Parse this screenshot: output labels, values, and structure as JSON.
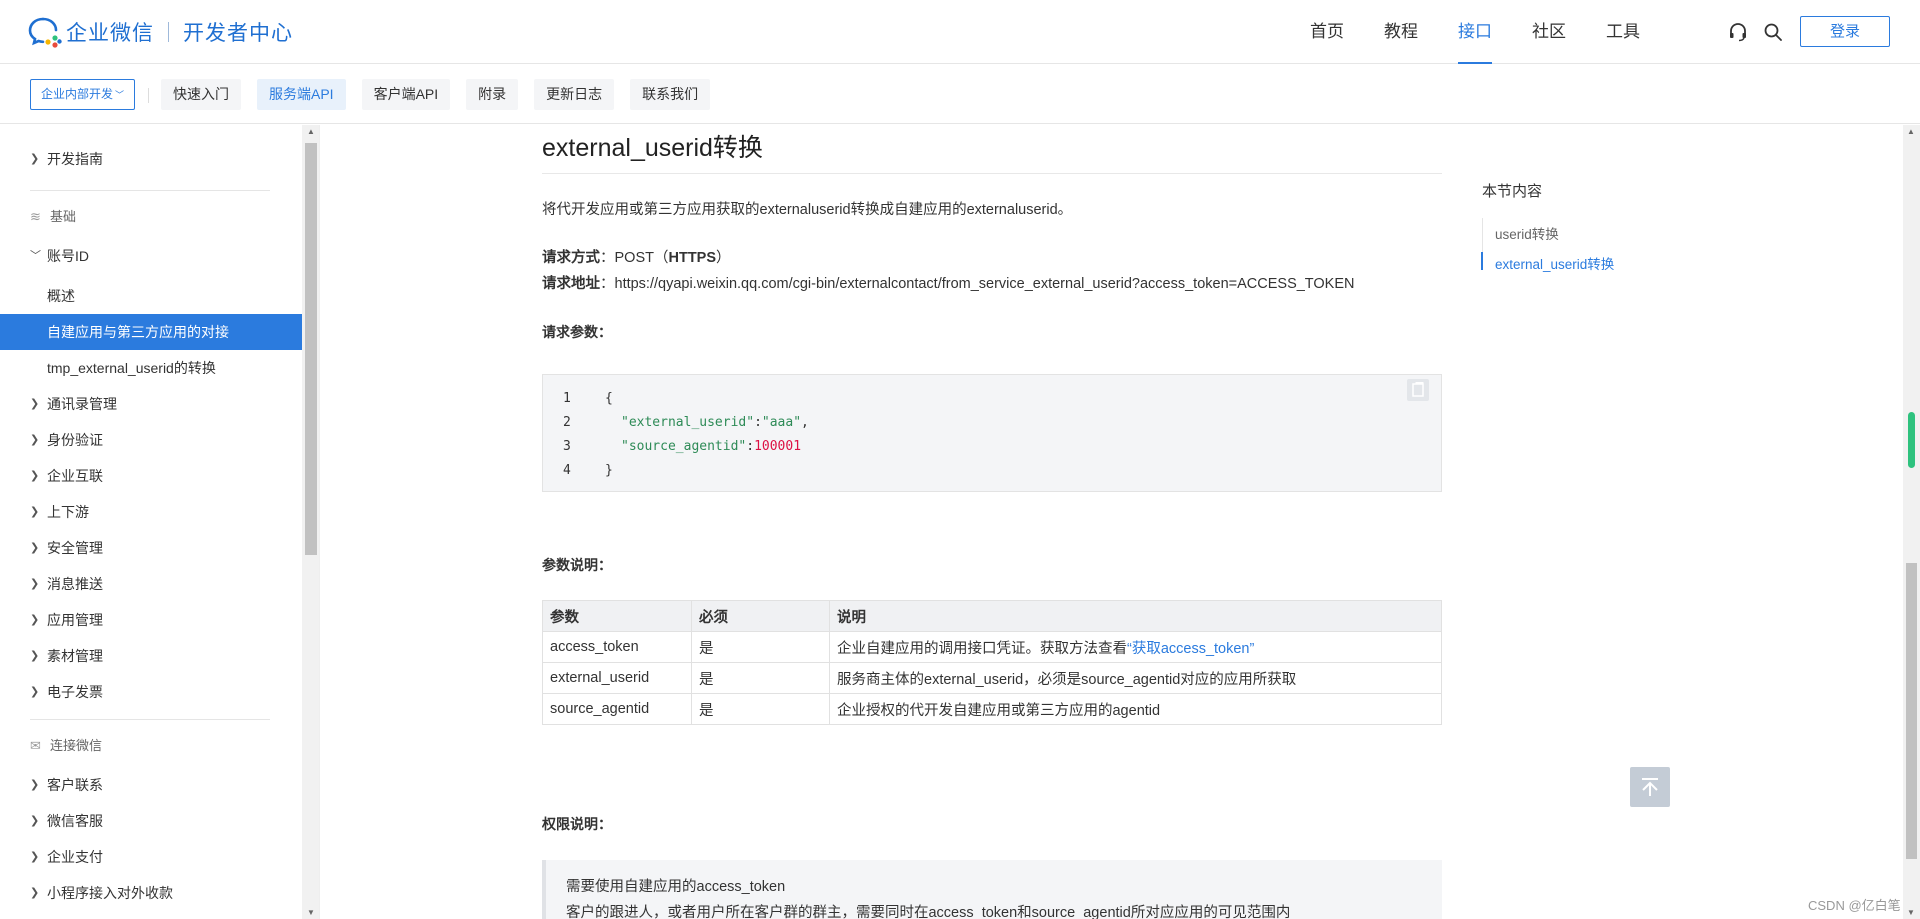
{
  "brand": {
    "name": "企业微信",
    "sub": "开发者中心"
  },
  "nav": {
    "items": [
      "首页",
      "教程",
      "接口",
      "社区",
      "工具"
    ],
    "active": "接口",
    "login": "登录"
  },
  "subnav": {
    "scope": "企业内部开发",
    "tabs": [
      "快速入门",
      "服务端API",
      "客户端API",
      "附录",
      "更新日志",
      "联系我们"
    ],
    "active": "服务端API"
  },
  "sidebar": {
    "dev_guide": "开发指南",
    "group_basic": "基础",
    "account_id": "账号ID",
    "overview": "概述",
    "active_item": "自建应用与第三方应用的对接",
    "tmp_convert": "tmp_external_userid的转换",
    "items_a": [
      "通讯录管理",
      "身份验证",
      "企业互联",
      "上下游",
      "安全管理",
      "消息推送",
      "应用管理",
      "素材管理",
      "电子发票"
    ],
    "group_wechat": "连接微信",
    "items_b": [
      "客户联系",
      "微信客服",
      "企业支付",
      "小程序接入对外收款"
    ]
  },
  "content": {
    "title": "external_userid转换",
    "desc": "将代开发应用或第三方应用获取的externaluserid转换成自建应用的externaluserid。",
    "method_label": "请求方式",
    "method_value": "：POST（",
    "method_proto": "HTTPS",
    "method_end": "）",
    "url_label": "请求地址",
    "url_value": "：https://qyapi.weixin.qq.com/cgi-bin/externalcontact/from_service_external_userid?access_token=ACCESS_TOKEN",
    "params_label": "请求参数：",
    "code": {
      "line_numbers": [
        "1",
        "2",
        "3",
        "4"
      ],
      "open_brace": "{",
      "k1": "\"external_userid\"",
      "v1": "\"aaa\"",
      "k2": "\"source_agentid\"",
      "v2": "100001",
      "close_brace": "}"
    },
    "params_desc_label": "参数说明：",
    "table": {
      "headers": [
        "参数",
        "必须",
        "说明"
      ],
      "rows": [
        {
          "param": "access_token",
          "required": "是",
          "desc_prefix": "企业自建应用的调用接口凭证。获取方法查看",
          "desc_link": "“获取access_token”"
        },
        {
          "param": "external_userid",
          "required": "是",
          "desc": "服务商主体的external_userid，必须是source_agentid对应的应用所获取"
        },
        {
          "param": "source_agentid",
          "required": "是",
          "desc": "企业授权的代开发自建应用或第三方应用的agentid"
        }
      ]
    },
    "perm_label": "权限说明：",
    "note_lines": [
      "需要使用自建应用的access_token",
      "客户的跟进人，或者用户所在客户群的群主，需要同时在access_token和source_agentid所对应应用的可见范围内"
    ]
  },
  "toc": {
    "title": "本节内容",
    "items": [
      "userid转换",
      "external_userid转换"
    ],
    "active": "external_userid转换"
  },
  "watermark": "CSDN @亿白笔",
  "colors": {
    "accent": "#2b7bde",
    "scroll_indicator": "#2ec27e"
  }
}
